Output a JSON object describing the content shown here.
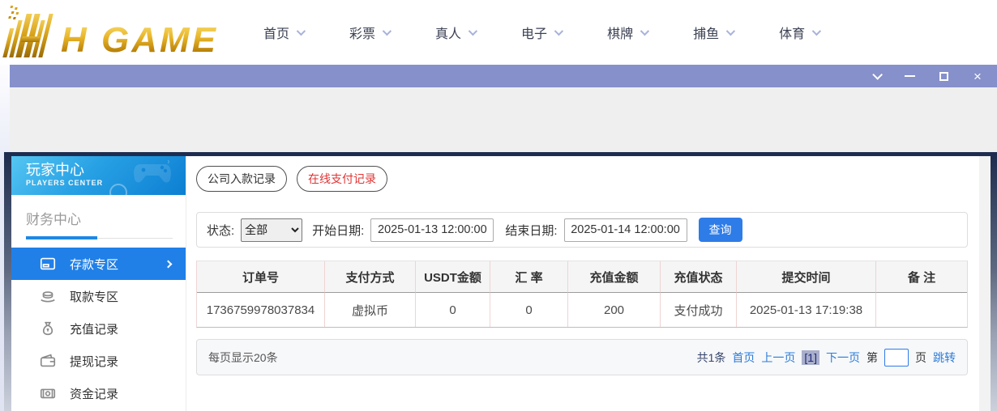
{
  "header": {
    "logo_text": "H GAME",
    "nav": [
      "首页",
      "彩票",
      "真人",
      "电子",
      "棋牌",
      "捕鱼",
      "体育"
    ]
  },
  "titlebar": {
    "icons": [
      "chevron-down",
      "minimize",
      "maximize",
      "close"
    ],
    "close_glyph": "×"
  },
  "sidebar": {
    "title": "玩家中心",
    "subtitle": "PLAYERS  CENTER",
    "section": "财务中心",
    "items": [
      {
        "label": "存款专区",
        "icon": "deposit-card-icon",
        "active": true
      },
      {
        "label": "取款专区",
        "icon": "withdraw-hand-icon",
        "active": false
      },
      {
        "label": "充值记录",
        "icon": "money-bag-icon",
        "active": false
      },
      {
        "label": "提现记录",
        "icon": "wallet-icon",
        "active": false
      },
      {
        "label": "资金记录",
        "icon": "funds-icon",
        "active": false
      }
    ]
  },
  "tabs": [
    {
      "label": "公司入款记录",
      "active": false
    },
    {
      "label": "在线支付记录",
      "active": true
    }
  ],
  "filters": {
    "status_label": "状态:",
    "status_value": "全部",
    "start_label": "开始日期:",
    "start_value": "2025-01-13 12:00:00",
    "end_label": "结束日期:",
    "end_value": "2025-01-14 12:00:00",
    "search_label": "查询"
  },
  "table": {
    "headers": [
      "订单号",
      "支付方式",
      "USDT金额",
      "汇 率",
      "充值金额",
      "充值状态",
      "提交时间",
      "备 注"
    ],
    "rows": [
      [
        "1736759978037834",
        "虚拟币",
        "0",
        "0",
        "200",
        "支付成功",
        "2025-01-13 17:19:38",
        ""
      ]
    ]
  },
  "pagination": {
    "page_size_text": "每页显示20条",
    "total": "共1条",
    "first": "首页",
    "prev": "上一页",
    "current": "[1]",
    "next": "下一页",
    "jump_prefix": "第",
    "jump_suffix": "页",
    "jump": "跳转"
  },
  "colors": {
    "titlebar": "#8690cb",
    "sidebar_active": "#2080e8",
    "accent_blue": "#2e7ce8",
    "link_blue": "#2b7bd9",
    "tab_red": "#e23434",
    "logo_gold": "#d9a41e"
  }
}
